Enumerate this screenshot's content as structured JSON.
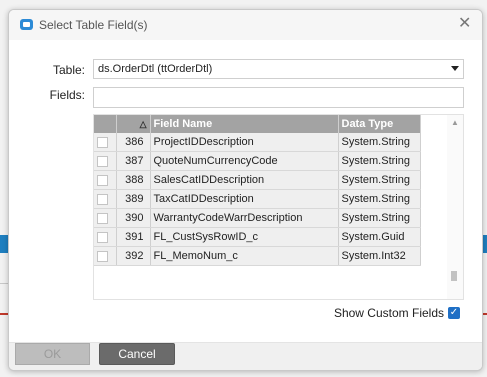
{
  "dialog": {
    "title": "Select Table Field(s)",
    "close_icon": "close-icon"
  },
  "form": {
    "table_label": "Table:",
    "table_value": "ds.OrderDtl (ttOrderDtl)",
    "fields_label": "Fields:",
    "fields_value": ""
  },
  "grid": {
    "columns": [
      "Field Name",
      "Data Type"
    ],
    "rows": [
      {
        "num": "386",
        "field": "ProjectIDDescription",
        "type": "System.String"
      },
      {
        "num": "387",
        "field": "QuoteNumCurrencyCode",
        "type": "System.String"
      },
      {
        "num": "388",
        "field": "SalesCatIDDescription",
        "type": "System.String"
      },
      {
        "num": "389",
        "field": "TaxCatIDDescription",
        "type": "System.String"
      },
      {
        "num": "390",
        "field": "WarrantyCodeWarrDescription",
        "type": "System.String"
      },
      {
        "num": "391",
        "field": "FL_CustSysRowID_c",
        "type": "System.Guid"
      },
      {
        "num": "392",
        "field": "FL_MemoNum_c",
        "type": "System.Int32"
      }
    ]
  },
  "options": {
    "show_custom_label": "Show Custom Fields",
    "show_custom_checked": true
  },
  "buttons": {
    "ok": "OK",
    "cancel": "Cancel"
  },
  "colors": {
    "accent": "#1f6fc5",
    "header_bg": "#a3a3a3"
  }
}
